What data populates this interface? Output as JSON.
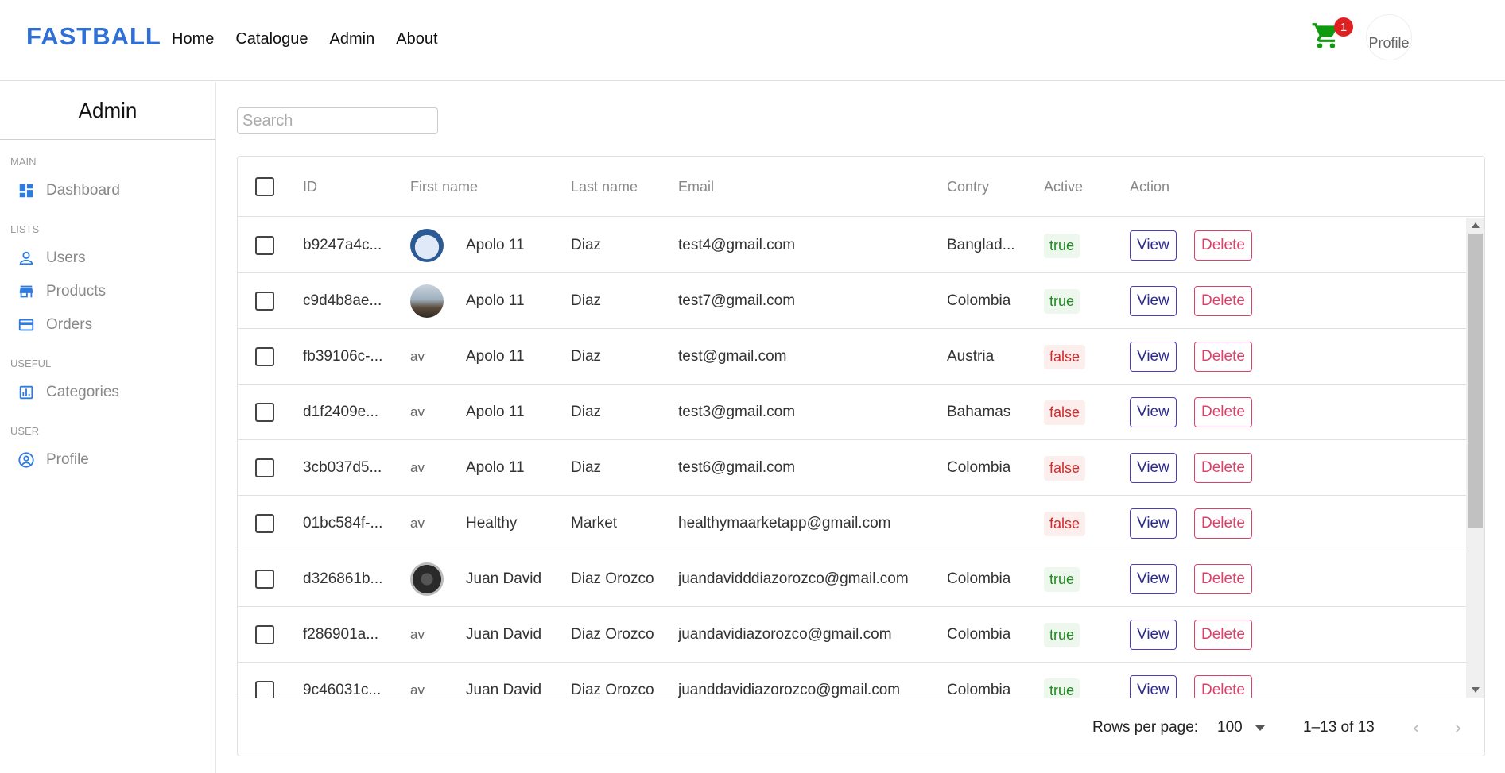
{
  "brand": {
    "logo_text": "FASTBALL",
    "logo_color": "#2f6fd6"
  },
  "nav": {
    "items": [
      "Home",
      "Catalogue",
      "Admin",
      "About"
    ]
  },
  "cart": {
    "icon": "cart-icon",
    "count": "1",
    "color": "#0e9b0e"
  },
  "profile_avatar": {
    "alt": "Profile"
  },
  "sidebar": {
    "title": "Admin",
    "sections": [
      {
        "label": "MAIN",
        "items": [
          {
            "label": "Dashboard",
            "icon": "dashboard-icon"
          }
        ]
      },
      {
        "label": "LISTS",
        "items": [
          {
            "label": "Users",
            "icon": "person-icon"
          },
          {
            "label": "Products",
            "icon": "store-icon"
          },
          {
            "label": "Orders",
            "icon": "credit-card-icon"
          }
        ]
      },
      {
        "label": "USEFUL",
        "items": [
          {
            "label": "Categories",
            "icon": "chart-icon"
          }
        ]
      },
      {
        "label": "USER",
        "items": [
          {
            "label": "Profile",
            "icon": "account-circle-icon"
          }
        ]
      }
    ]
  },
  "search": {
    "placeholder": "Search",
    "value": ""
  },
  "table": {
    "columns": [
      "ID",
      "First name",
      "Last name",
      "Email",
      "Contry",
      "Active",
      "Action"
    ],
    "rows": [
      {
        "id": "b9247a4c...",
        "avatar": "av-blue",
        "first": "Apolo 11",
        "last": "Diaz",
        "email": "test4@gmail.com",
        "country": "Banglad...",
        "active": "true"
      },
      {
        "id": "c9d4b8ae...",
        "avatar": "av-photo1",
        "first": "Apolo 11",
        "last": "Diaz",
        "email": "test7@gmail.com",
        "country": "Colombia",
        "active": "true"
      },
      {
        "id": "fb39106c-...",
        "avatar": "av-broken",
        "first": "Apolo 11",
        "last": "Diaz",
        "email": "test@gmail.com",
        "country": "Austria",
        "active": "false"
      },
      {
        "id": "d1f2409e...",
        "avatar": "av-broken",
        "first": "Apolo 11",
        "last": "Diaz",
        "email": "test3@gmail.com",
        "country": "Bahamas",
        "active": "false"
      },
      {
        "id": "3cb037d5...",
        "avatar": "av-broken",
        "first": "Apolo 11",
        "last": "Diaz",
        "email": "test6@gmail.com",
        "country": "Colombia",
        "active": "false"
      },
      {
        "id": "01bc584f-...",
        "avatar": "av-broken",
        "first": "Healthy",
        "last": "Market",
        "email": "healthymaarketapp@gmail.com",
        "country": "",
        "active": "false"
      },
      {
        "id": "d326861b...",
        "avatar": "av-photo2",
        "first": "Juan David",
        "last": "Diaz Orozco",
        "email": "juandavidddiazorozco@gmail.com",
        "country": "Colombia",
        "active": "true"
      },
      {
        "id": "f286901a...",
        "avatar": "av-broken",
        "first": "Juan David",
        "last": "Diaz Orozco",
        "email": "juandavidiazorozco@gmail.com",
        "country": "Colombia",
        "active": "true"
      },
      {
        "id": "9c46031c...",
        "avatar": "av-broken",
        "first": "Juan David",
        "last": "Diaz Orozco",
        "email": "juanddavidiazorozco@gmail.com",
        "country": "Colombia",
        "active": "true"
      }
    ],
    "broken_avatar_alt": "av",
    "view_label": "View",
    "delete_label": "Delete"
  },
  "pagination": {
    "rows_per_page_label": "Rows per page:",
    "rows_per_page": "100",
    "range": "1–13 of 13"
  }
}
